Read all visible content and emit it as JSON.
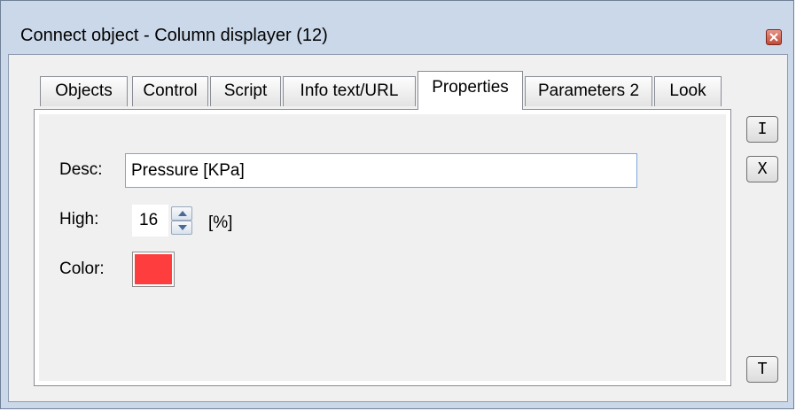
{
  "window": {
    "title": "Connect object - Column displayer (12)"
  },
  "tabs": [
    {
      "label": "Objects",
      "active": false
    },
    {
      "label": "Control",
      "active": false
    },
    {
      "label": "Script",
      "active": false
    },
    {
      "label": "Info text/URL",
      "active": false
    },
    {
      "label": "Properties",
      "active": true
    },
    {
      "label": "Parameters 2",
      "active": false
    },
    {
      "label": "Look",
      "active": false
    }
  ],
  "properties": {
    "desc_label": "Desc:",
    "desc_value": "Pressure [KPa]",
    "high_label": "High:",
    "high_value": "16",
    "high_unit": "[%]",
    "color_label": "Color:",
    "color_value": "#fe3e3e"
  },
  "side_buttons": {
    "insert_label": "I",
    "clear_label": "X",
    "text_label": "T"
  },
  "colors": {
    "frame": "#cbd8e9",
    "client": "#f0f0f0",
    "input_border": "#7aa6d9",
    "close_button": "#c24a36"
  }
}
